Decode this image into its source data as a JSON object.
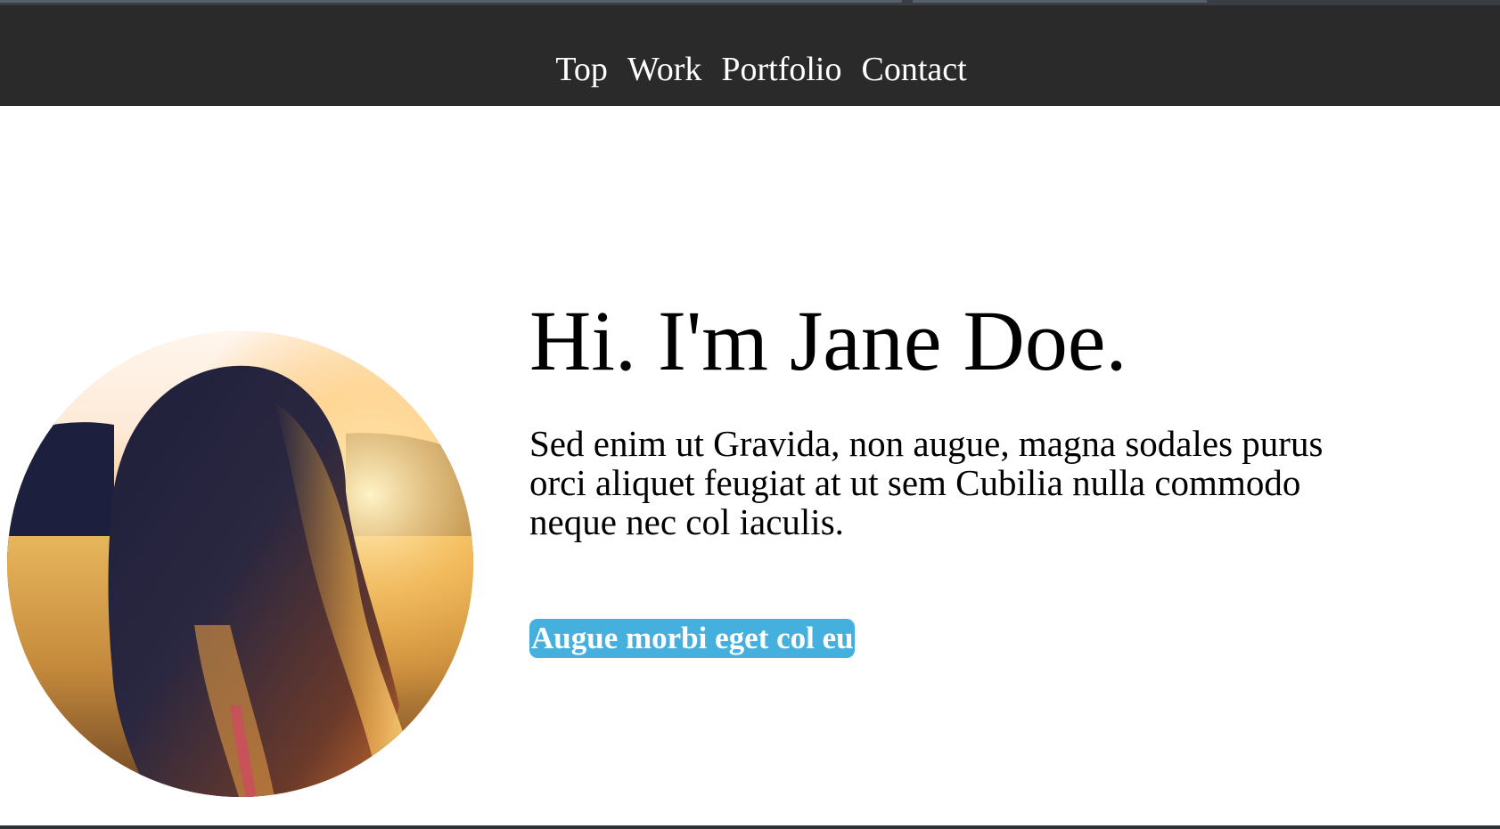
{
  "nav": {
    "items": [
      {
        "label": "Top"
      },
      {
        "label": "Work"
      },
      {
        "label": "Portfolio"
      },
      {
        "label": "Contact"
      }
    ]
  },
  "hero": {
    "heading": "Hi. I'm Jane Doe.",
    "intro": "Sed enim ut Gravida, non augue, magna sodales purus orci aliquet feugiat at ut sem Cubilia nulla commodo neque nec col iaculis.",
    "button_label": "Augue morbi eget col eu"
  },
  "colors": {
    "navbar_bg": "#2a2a2a",
    "page_bg": "#ffffff",
    "button_bg": "#45b0de",
    "button_text": "#ffffff",
    "nav_text": "#ffffff"
  }
}
